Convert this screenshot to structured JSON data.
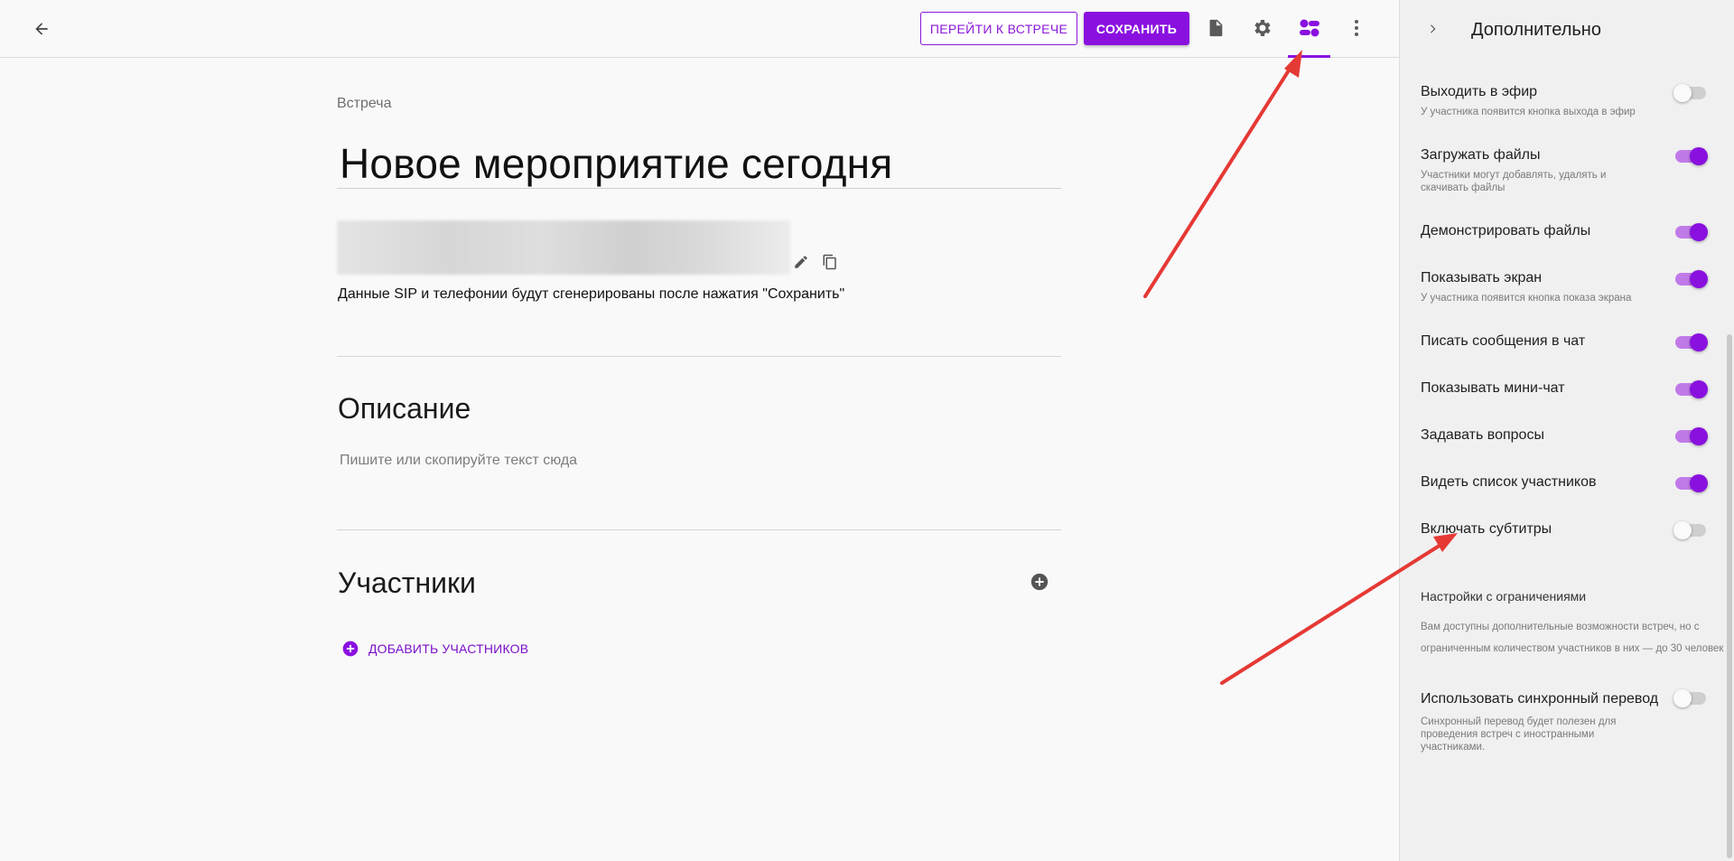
{
  "topbar": {
    "go_to_meeting_label": "ПЕРЕЙТИ К ВСТРЕЧЕ",
    "save_label": "СОХРАНИТЬ"
  },
  "meeting": {
    "kicker": "Встреча",
    "title": "Новое мероприятие сегодня",
    "sip_note": "Данные SIP и телефонии будут сгенерированы после нажатия \"Сохранить\"",
    "description_heading": "Описание",
    "description_placeholder": "Пишите или скопируйте текст сюда",
    "participants_heading": "Участники",
    "add_participants_label": "ДОБАВИТЬ УЧАСТНИКОВ"
  },
  "panel": {
    "title": "Дополнительно",
    "options": [
      {
        "label": "Выходить в эфир",
        "sub": "У участника появится кнопка выхода в эфир",
        "on": false
      },
      {
        "label": "Загружать файлы",
        "sub": "Участники могут добавлять, удалять и скачивать файлы",
        "on": true
      },
      {
        "label": "Демонстрировать файлы",
        "sub": "",
        "on": true
      },
      {
        "label": "Показывать экран",
        "sub": "У участника появится кнопка показа экрана",
        "on": true
      },
      {
        "label": "Писать сообщения в чат",
        "sub": "",
        "on": true
      },
      {
        "label": "Показывать мини-чат",
        "sub": "",
        "on": true
      },
      {
        "label": "Задавать вопросы",
        "sub": "",
        "on": true
      },
      {
        "label": "Видеть список участников",
        "sub": "",
        "on": true
      },
      {
        "label": "Включать субтитры",
        "sub": "",
        "on": false
      }
    ],
    "restricted_title": "Настройки с ограничениями",
    "restricted_text": "Вам доступны дополнительные возможности встреч, но с ограниченным количеством участников в них — до 30 человек",
    "translation": {
      "label": "Использовать синхронный перевод",
      "sub": "Синхронный перевод будет полезен для проведения встреч с иностранными участниками.",
      "on": false
    }
  },
  "colors": {
    "accent": "#8a10e0",
    "annotation_arrow": "#e53935"
  }
}
